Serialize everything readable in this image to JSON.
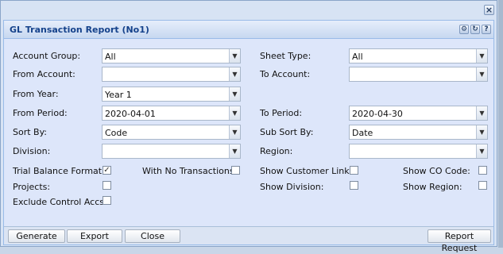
{
  "window": {
    "close_icon": "close-icon"
  },
  "dialog": {
    "title": "GL Transaction Report (No1)",
    "tools": {
      "gear": "gear-icon",
      "refresh": "refresh-icon",
      "help": "?"
    }
  },
  "form": {
    "account_group": {
      "label": "Account Group:",
      "value": "All"
    },
    "sheet_type": {
      "label": "Sheet Type:",
      "value": "All"
    },
    "from_account": {
      "label": "From Account:",
      "value": ""
    },
    "to_account": {
      "label": "To Account:",
      "value": ""
    },
    "from_year": {
      "label": "From Year:",
      "value": "Year 1"
    },
    "from_period": {
      "label": "From Period:",
      "value": "2020-04-01"
    },
    "to_period": {
      "label": "To Period:",
      "value": "2020-04-30"
    },
    "sort_by": {
      "label": "Sort By:",
      "value": "Code"
    },
    "sub_sort_by": {
      "label": "Sub Sort By:",
      "value": "Date"
    },
    "division": {
      "label": "Division:",
      "value": ""
    },
    "region": {
      "label": "Region:",
      "value": ""
    },
    "checks": {
      "trial_balance_format": {
        "label": "Trial Balance Format:",
        "checked": true
      },
      "with_no_transactions": {
        "label": "With No Transactions:",
        "checked": false
      },
      "show_customer_link": {
        "label": "Show Customer Link:",
        "checked": false
      },
      "show_co_code": {
        "label": "Show CO Code:",
        "checked": false
      },
      "projects": {
        "label": "Projects:",
        "checked": false
      },
      "show_division": {
        "label": "Show Division:",
        "checked": false
      },
      "show_region": {
        "label": "Show Region:",
        "checked": false
      },
      "exclude_control_accs": {
        "label": "Exclude Control Accs:",
        "checked": false
      }
    }
  },
  "buttons": {
    "generate": "Generate",
    "export": "Export",
    "close": "Close",
    "report_request": "Report Request"
  },
  "colors": {
    "title_text": "#15428b",
    "panel_bg": "#dde6fa",
    "border": "#99bbe8"
  }
}
